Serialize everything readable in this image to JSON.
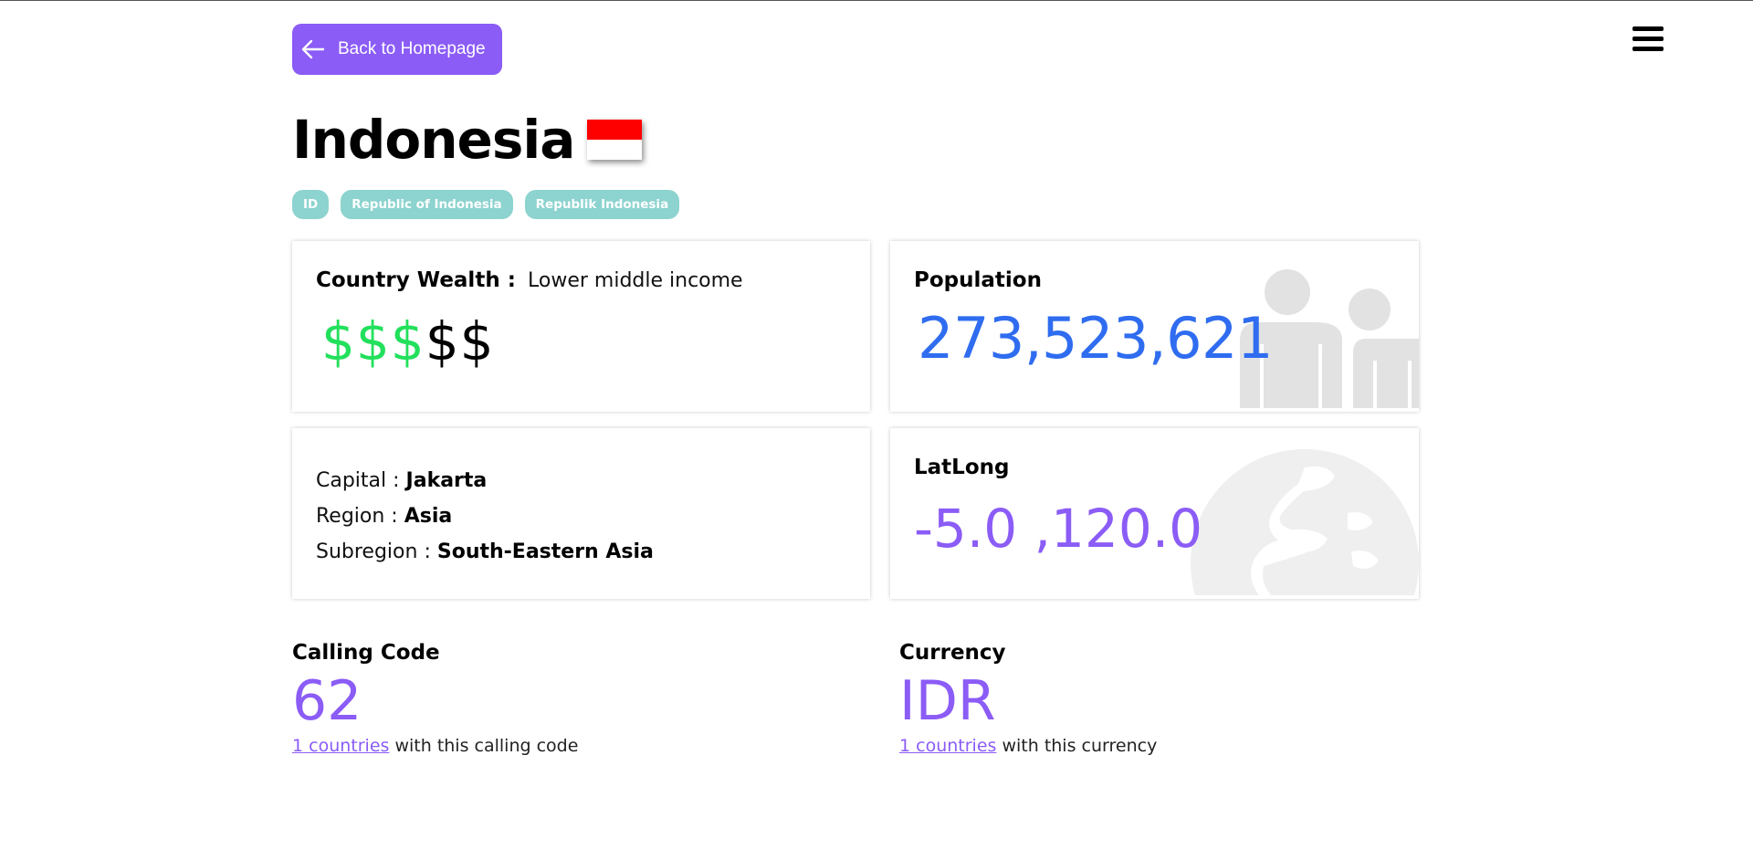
{
  "nav": {
    "back_label": "Back to Homepage"
  },
  "country": {
    "name": "Indonesia",
    "flag_colors": [
      "#ff0000",
      "#ffffff"
    ],
    "badges": [
      "ID",
      "Republic of Indonesia",
      "Republik Indonesia"
    ]
  },
  "wealth": {
    "label": "Country Wealth :",
    "value": "Lower middle income",
    "dollars_filled": "$$$",
    "dollars_empty": "$$",
    "filled_color": "#22e05c"
  },
  "population": {
    "label": "Population",
    "value": "273,523,621",
    "icon": "people-icon"
  },
  "info": {
    "capital_label": "Capital :",
    "capital": "Jakarta",
    "region_label": "Region :",
    "region": "Asia",
    "subregion_label": "Subregion :",
    "subregion": "South-Eastern Asia"
  },
  "latlong": {
    "label": "LatLong",
    "value": "-5.0 ,120.0",
    "icon": "globe-icon"
  },
  "calling_code": {
    "label": "Calling Code",
    "value": "62",
    "link": "1 countries",
    "suffix": "with this calling code"
  },
  "currency": {
    "label": "Currency",
    "value": "IDR",
    "link": "1 countries",
    "suffix": "with this currency"
  },
  "colors": {
    "accent": "#8b5cf6",
    "population": "#2f6cf0",
    "badge": "#8dd3cf"
  }
}
